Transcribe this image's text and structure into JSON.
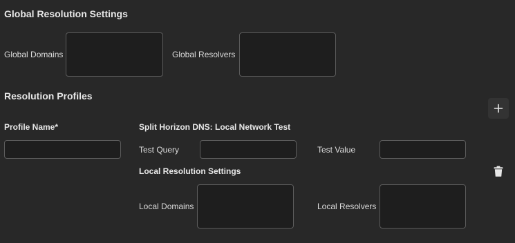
{
  "global": {
    "title": "Global Resolution Settings",
    "domains_label": "Global Domains",
    "domains_value": "",
    "resolvers_label": "Global Resolvers",
    "resolvers_value": ""
  },
  "profiles": {
    "title": "Resolution Profiles",
    "add_icon": "plus-icon",
    "items": [
      {
        "profile_name_label": "Profile Name*",
        "profile_name_value": "",
        "split_horizon_title": "Split Horizon DNS: Local Network Test",
        "test_query_label": "Test Query",
        "test_query_value": "",
        "test_value_label": "Test Value",
        "test_value_value": "",
        "local_title": "Local Resolution Settings",
        "local_domains_label": "Local Domains",
        "local_domains_value": "",
        "local_resolvers_label": "Local Resolvers",
        "local_resolvers_value": "",
        "delete_icon": "trash-icon"
      }
    ]
  },
  "colors": {
    "background": "#282828",
    "field_background": "#1e1e1e",
    "field_border": "#5c5c5c",
    "text": "#e4e4e4"
  }
}
